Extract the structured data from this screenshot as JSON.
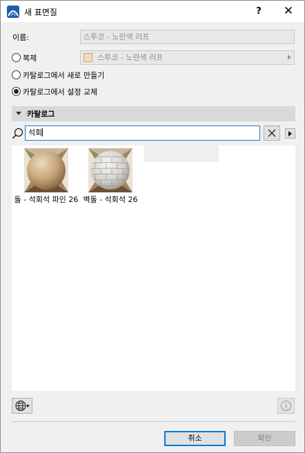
{
  "window": {
    "title": "새 표면질",
    "help_label": "?",
    "close_label": "✕",
    "app_icon": "archicad-icon"
  },
  "name_row": {
    "label": "이름:",
    "value": "스투코 - 노란색 러프"
  },
  "options": [
    {
      "label": "복제",
      "selected": false,
      "source_value": "스투코 - 노란색 러프"
    },
    {
      "label": "카탈로그에서 새로 만들기",
      "selected": false
    },
    {
      "label": "카탈로그에서 설정 교체",
      "selected": true
    }
  ],
  "swatch_color": "#f1dcb6",
  "catalog": {
    "header": "카탈로그",
    "search_value": "석회",
    "search_icon": "search-icon",
    "clear_icon": "clear-x-icon",
    "more_icon": "triangle-right-icon",
    "items": [
      {
        "label": "돌 - 석회석 파인 26",
        "thumb": "limestone-sphere",
        "color": "#c9a67a"
      },
      {
        "label": "벽돌 - 석회석 26",
        "thumb": "limestone-brick-sphere",
        "color": "#dedcd8"
      }
    ]
  },
  "footer": {
    "globe_icon": "globe-icon",
    "info_icon": "info-icon",
    "cancel_label": "취소",
    "ok_label": "확인"
  },
  "accent_color": "#0078d7"
}
